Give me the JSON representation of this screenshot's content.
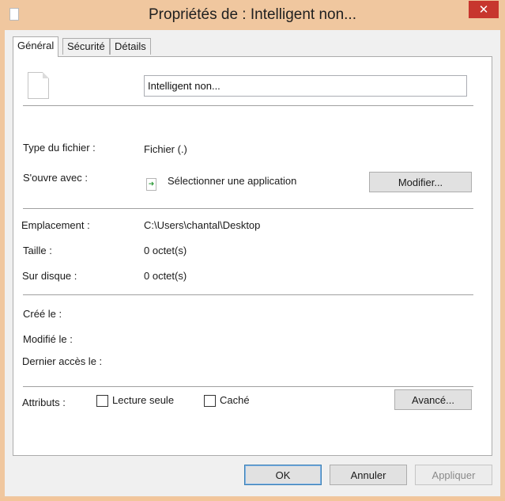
{
  "window": {
    "title": "Propriétés de : Intelligent non...",
    "close_glyph": "✕"
  },
  "tabs": [
    {
      "label": "Général",
      "active": true
    },
    {
      "label": "Sécurité",
      "active": false
    },
    {
      "label": "Détails",
      "active": false
    }
  ],
  "general": {
    "file_name": "Intelligent non...",
    "file_type_label": "Type du fichier :",
    "file_type_value": "Fichier (.)",
    "opens_with_label": "S'ouvre avec :",
    "opens_with_value": "Sélectionner une application",
    "modify_button": "Modifier...",
    "location_label": "Emplacement :",
    "location_value": "C:\\Users\\chantal\\Desktop",
    "size_label": "Taille :",
    "size_value": "0 octet(s)",
    "on_disk_label": "Sur disque :",
    "on_disk_value": "0 octet(s)",
    "created_label": "Créé le :",
    "modified_label": "Modifié le :",
    "accessed_label": "Dernier accès le :",
    "attributes_label": "Attributs :",
    "readonly_label": "Lecture seule",
    "readonly_checked": false,
    "hidden_label": "Caché",
    "hidden_checked": false,
    "advanced_button": "Avancé..."
  },
  "footer": {
    "ok": "OK",
    "cancel": "Annuler",
    "apply": "Appliquer"
  },
  "colors": {
    "title_bar": "#f0c79f",
    "close_button": "#c7362e",
    "dialog_background": "#f0f0f0",
    "panel_background": "#ffffff"
  }
}
